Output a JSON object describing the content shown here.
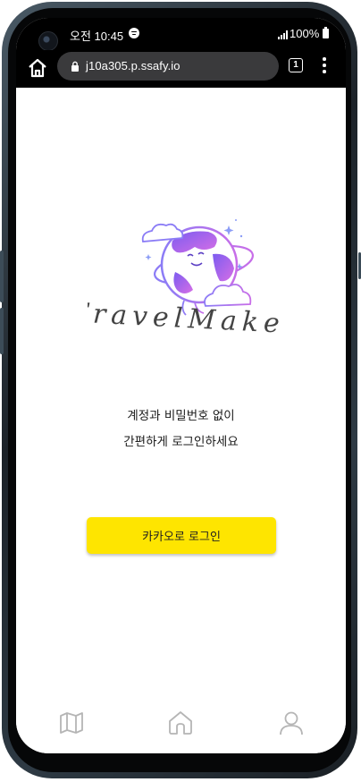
{
  "status_bar": {
    "time": "오전 10:45",
    "battery": "100%"
  },
  "browser": {
    "url": "j10a305.p.ssafy.io",
    "tab_count": "1"
  },
  "logo": {
    "wordmark": "TravelMaker"
  },
  "login": {
    "tagline_line1": "계정과 비밀번호 없이",
    "tagline_line2": "간편하게 로그인하세요",
    "kakao_button": "카카오로 로그인"
  },
  "colors": {
    "kakao_yellow": "#fee500",
    "logo_purple": "#8b5cf6",
    "logo_pink": "#e879f9",
    "nav_icon_gray": "#b5b5b5"
  },
  "bottom_nav": {
    "items": [
      {
        "icon": "map-icon"
      },
      {
        "icon": "home-icon"
      },
      {
        "icon": "user-icon"
      }
    ]
  }
}
